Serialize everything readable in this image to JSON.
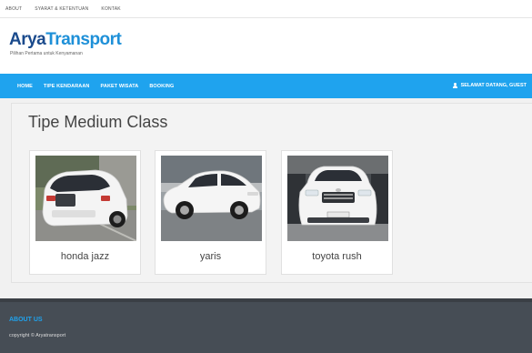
{
  "topbar": {
    "links": [
      "ABOUT",
      "SYARAT & KETENTUAN",
      "KONTAK"
    ]
  },
  "brand": {
    "name_part1": "Arya",
    "name_part2": "Transport",
    "tagline": "Pilihan Pertama untuk Kenyamanan",
    "colors": {
      "part1": "#1a4a8c",
      "part2": "#1e90d8"
    }
  },
  "nav": {
    "items": [
      "HOME",
      "TIPE KENDARAAN",
      "PAKET WISATA",
      "BOOKING"
    ],
    "greeting": "SELAMAT DATANG, GUEST",
    "color": "#1fa3ee"
  },
  "main": {
    "title": "Tipe Medium Class",
    "cars": [
      {
        "name": "honda jazz",
        "image": "white-hatchback-rear-photo"
      },
      {
        "name": "yaris",
        "image": "white-hatchback-side-photo"
      },
      {
        "name": "toyota rush",
        "image": "white-suv-front-photo"
      }
    ]
  },
  "footer": {
    "title": "ABOUT US",
    "copyright": "copyright © Aryatransport",
    "bg_color": "#464d55"
  }
}
